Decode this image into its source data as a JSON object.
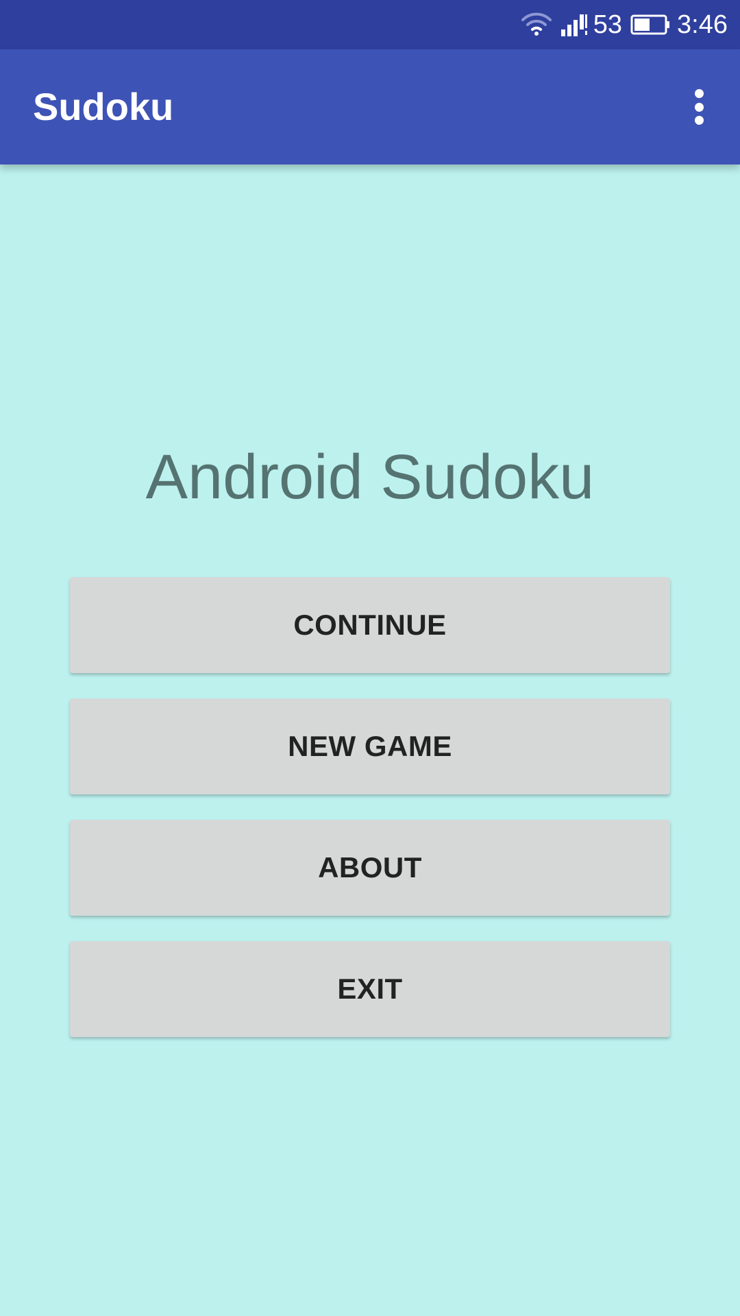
{
  "status_bar": {
    "signal_label": "53",
    "time": "3:46",
    "icons": [
      "wifi-icon",
      "cell-signal-icon",
      "battery-icon"
    ]
  },
  "app_bar": {
    "title": "Sudoku",
    "overflow_icon": "more-vert-icon"
  },
  "main": {
    "headline": "Android Sudoku",
    "buttons": {
      "continue": "CONTINUE",
      "new_game": "NEW GAME",
      "about": "ABOUT",
      "exit": "EXIT"
    }
  },
  "colors": {
    "status_bar": "#2f3f9e",
    "app_bar": "#3e53b6",
    "background": "#bcf1ee",
    "headline_text": "#557371",
    "button_bg": "#d6d8d8",
    "button_text": "#222222"
  }
}
